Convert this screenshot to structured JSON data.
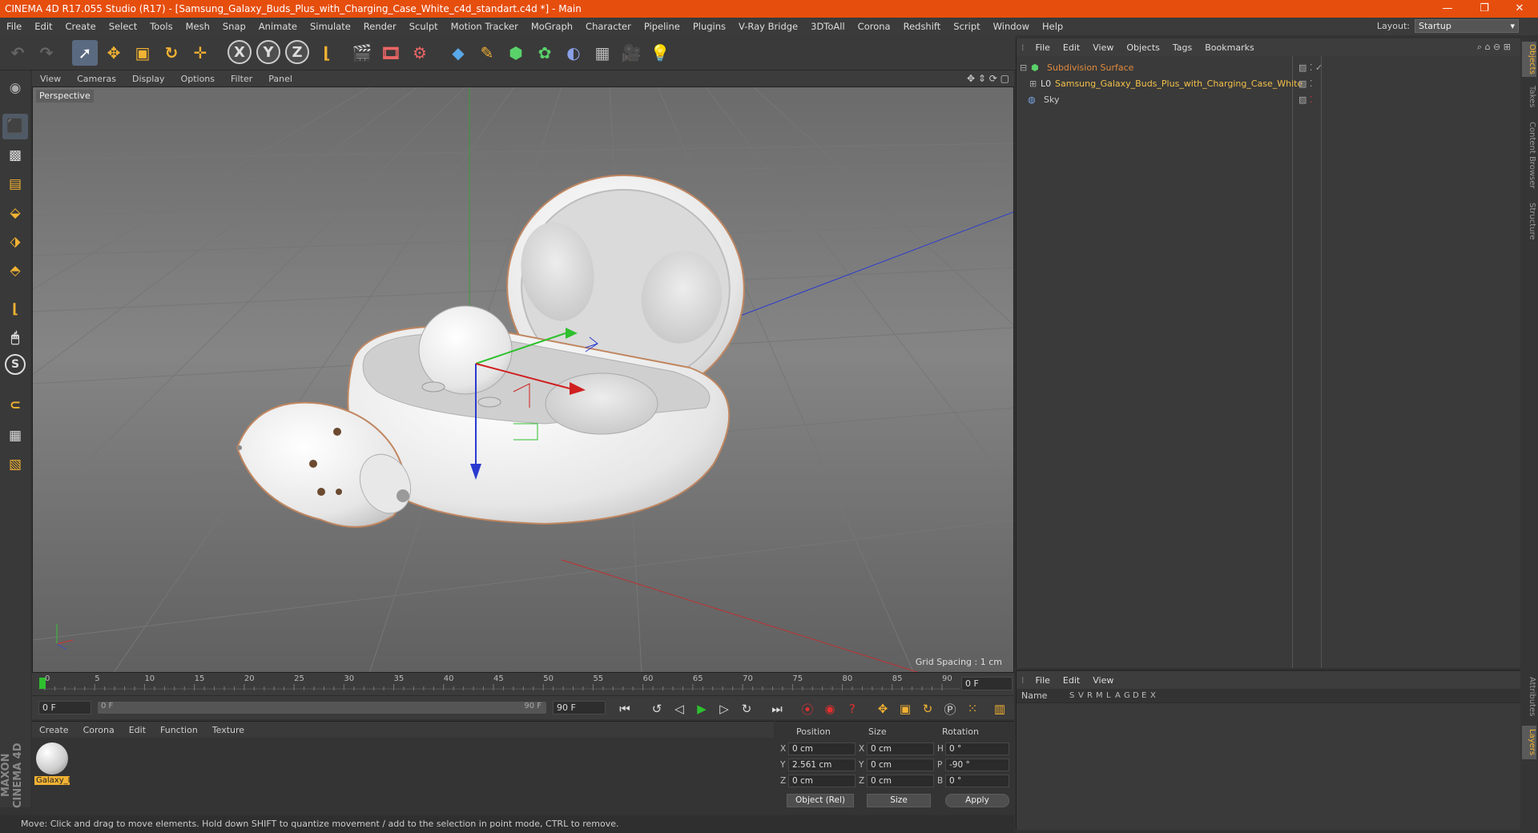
{
  "window": {
    "title": "CINEMA 4D R17.055 Studio (R17) - [Samsung_Galaxy_Buds_Plus_with_Charging_Case_White_c4d_standart.c4d *] - Main",
    "minimize": "—",
    "restore": "❐",
    "close": "✕"
  },
  "menubar": {
    "items": [
      "File",
      "Edit",
      "Create",
      "Select",
      "Tools",
      "Mesh",
      "Snap",
      "Animate",
      "Simulate",
      "Render",
      "Sculpt",
      "Motion Tracker",
      "MoGraph",
      "Character",
      "Pipeline",
      "Plugins",
      "V-Ray Bridge",
      "3DToAll",
      "Corona",
      "Redshift",
      "Script",
      "Window",
      "Help"
    ],
    "layout_label": "Layout:",
    "layout_value": "Startup"
  },
  "toolbar": {
    "axis_x": "X",
    "axis_y": "Y",
    "axis_z": "Z"
  },
  "viewport": {
    "menu": [
      "View",
      "Cameras",
      "Display",
      "Options",
      "Filter",
      "Panel"
    ],
    "label": "Perspective",
    "grid_spacing": "Grid Spacing : 1 cm"
  },
  "timeline": {
    "ticks": [
      "0",
      "5",
      "10",
      "15",
      "20",
      "25",
      "30",
      "35",
      "40",
      "45",
      "50",
      "55",
      "60",
      "65",
      "70",
      "75",
      "80",
      "85",
      "90"
    ],
    "current_frame": "0 F",
    "start_field": "0 F",
    "range_left": "0 F",
    "range_right": "90 F",
    "end_field": "90 F"
  },
  "material_manager": {
    "menu": [
      "Create",
      "Corona",
      "Edit",
      "Function",
      "Texture"
    ],
    "material_name": "Galaxy_I"
  },
  "coordinates": {
    "headers": {
      "position": "Position",
      "size": "Size",
      "rotation": "Rotation"
    },
    "rows": [
      {
        "axis": "X",
        "pos": "0 cm",
        "saxis": "X",
        "size": "0 cm",
        "raxis": "H",
        "rot": "0 °"
      },
      {
        "axis": "Y",
        "pos": "2.561 cm",
        "saxis": "Y",
        "size": "0 cm",
        "raxis": "P",
        "rot": "-90 °"
      },
      {
        "axis": "Z",
        "pos": "0 cm",
        "saxis": "Z",
        "size": "0 cm",
        "raxis": "B",
        "rot": "0 °"
      }
    ],
    "mode": "Object (Rel)",
    "size_mode": "Size",
    "apply": "Apply"
  },
  "status": "Move: Click and drag to move elements. Hold down SHIFT to quantize movement / add to the selection in point mode, CTRL to remove.",
  "brand": "MAXON CINEMA 4D",
  "object_manager": {
    "menu": [
      "File",
      "Edit",
      "View",
      "Objects",
      "Tags",
      "Bookmarks"
    ],
    "objects": [
      {
        "name": "Subdivision Surface",
        "color": "#e08a3c"
      },
      {
        "name": "Samsung_Galaxy_Buds_Plus_with_Charging_Case_White",
        "color": "#f2c04a"
      },
      {
        "name": "Sky",
        "color": "#cccccc"
      }
    ]
  },
  "attribute_manager": {
    "menu": [
      "File",
      "Edit",
      "View"
    ],
    "name_col": "Name",
    "flags": [
      "S",
      "V",
      "R",
      "M",
      "L",
      "A",
      "G",
      "D",
      "E",
      "X"
    ]
  },
  "right_tabs": [
    "Objects",
    "Takes",
    "Content Browser",
    "Structure",
    "Attributes",
    "Layers"
  ]
}
